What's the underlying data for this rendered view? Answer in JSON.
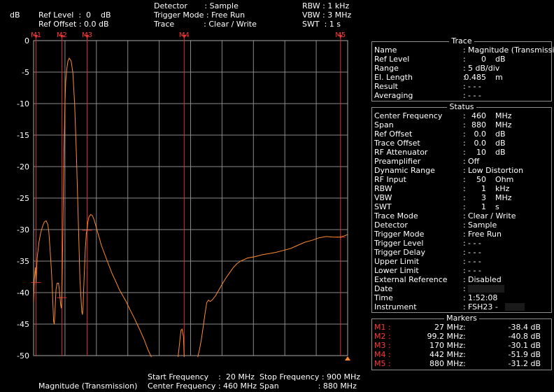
{
  "header": {
    "ylabel": "dB",
    "ref_level": "Ref Level  :  0    dB",
    "ref_offset": "Ref Offset : 0.0 dB",
    "detector": "Detector       : Sample",
    "trigger_mode": "Trigger Mode : Free Run",
    "trace": "Trace            : Clear / Write",
    "rbw": "RBW : 1 kHz",
    "vbw": "VBW : 3 MHz",
    "swt": "SWT  : 1 s"
  },
  "footer": {
    "mode": "Magnitude (Transmission)",
    "start_label": "Start Frequency    :  20 MHz",
    "center_label": "Center Frequency : 460 MHz",
    "stop_label": "Stop Frequency : 900 MHz",
    "span_label": "Span                : 880 MHz"
  },
  "marker_tags": [
    "M1",
    "M2",
    "M3",
    "M4",
    "M5"
  ],
  "trace_panel": {
    "title": "Trace",
    "rows": [
      {
        "label": "Name",
        "value": "Magnitude (Transmission)",
        "num": "",
        "unit": ""
      },
      {
        "label": "Ref Level",
        "value": "",
        "num": "0",
        "unit": "dB"
      },
      {
        "label": "Range",
        "value": "5 dB/div",
        "num": "",
        "unit": ""
      },
      {
        "label": "El. Length",
        "value": "",
        "num": "0.485",
        "unit": "m"
      },
      {
        "label": "Result",
        "value": "- - -",
        "num": "",
        "unit": ""
      },
      {
        "label": "Averaging",
        "value": "- - -",
        "num": "",
        "unit": ""
      }
    ]
  },
  "status_panel": {
    "title": "Status",
    "rows": [
      {
        "label": "Center Frequency",
        "value": "",
        "num": "460",
        "unit": "MHz"
      },
      {
        "label": "Span",
        "value": "",
        "num": "880",
        "unit": "MHz"
      },
      {
        "label": "Ref Offset",
        "value": "",
        "num": "0.0",
        "unit": "dB"
      },
      {
        "label": "Trace Offset",
        "value": "",
        "num": "0.0",
        "unit": "dB"
      },
      {
        "label": "RF Attenuator",
        "value": "",
        "num": "10",
        "unit": "dB"
      },
      {
        "label": "Preamplifier",
        "value": "Off",
        "num": "",
        "unit": ""
      },
      {
        "label": "Dynamic Range",
        "value": "Low Distortion",
        "num": "",
        "unit": ""
      },
      {
        "label": "RF Input",
        "value": "",
        "num": "50",
        "unit": "Ohm"
      },
      {
        "label": "RBW",
        "value": "",
        "num": "1",
        "unit": "kHz"
      },
      {
        "label": "VBW",
        "value": "",
        "num": "3",
        "unit": "MHz"
      },
      {
        "label": "SWT",
        "value": "",
        "num": "1",
        "unit": "s"
      },
      {
        "label": "Trace Mode",
        "value": "Clear / Write",
        "num": "",
        "unit": ""
      },
      {
        "label": "Detector",
        "value": "Sample",
        "num": "",
        "unit": ""
      },
      {
        "label": "Trigger Mode",
        "value": "Free Run",
        "num": "",
        "unit": ""
      },
      {
        "label": "Trigger Level",
        "value": "- - -",
        "num": "",
        "unit": ""
      },
      {
        "label": "Trigger Delay",
        "value": "- - -",
        "num": "",
        "unit": ""
      },
      {
        "label": "Upper Limit",
        "value": "- - -",
        "num": "",
        "unit": ""
      },
      {
        "label": "Lower Limit",
        "value": "- - -",
        "num": "",
        "unit": ""
      },
      {
        "label": "External Reference",
        "value": "Disabled",
        "num": "",
        "unit": ""
      },
      {
        "label": "Date",
        "value": "",
        "num": "",
        "unit": "",
        "redacted": true
      },
      {
        "label": "Time",
        "value": "1:52:08",
        "num": "",
        "unit": ""
      },
      {
        "label": "Instrument",
        "value": "FSH23 -",
        "num": "",
        "unit": "",
        "redacted": true
      }
    ]
  },
  "markers_panel": {
    "title": "Markers",
    "rows": [
      {
        "label": "M1 :",
        "freq": "27 MHz",
        "value": "-38.4 dB"
      },
      {
        "label": "M2 :",
        "freq": "99.2 MHz",
        "value": "-40.8 dB"
      },
      {
        "label": "M3 :",
        "freq": "170 MHz",
        "value": "-30.1 dB"
      },
      {
        "label": "M4 :",
        "freq": "442 MHz",
        "value": "-51.9 dB"
      },
      {
        "label": "M5 :",
        "freq": "880 MHz",
        "value": "-31.2 dB"
      }
    ]
  },
  "colors": {
    "trace": "#ff8a2a",
    "grid": "#8a8a8a",
    "marker": "#d83030",
    "marker_label": "#ff3a3a"
  },
  "chart_data": {
    "type": "line",
    "xlabel": "",
    "ylabel": "dB",
    "xlim": [
      20,
      900
    ],
    "ylim": [
      -50,
      0
    ],
    "yticks": [
      0,
      -5,
      -10,
      -15,
      -20,
      -25,
      -30,
      -35,
      -40,
      -45,
      -50
    ],
    "grid": true,
    "series": [
      {
        "name": "Magnitude (Transmission)",
        "x": [
          20,
          22,
          25,
          27,
          30,
          35,
          40,
          45,
          50,
          55,
          60,
          63,
          66,
          70,
          73,
          76,
          78,
          80,
          83,
          86,
          90,
          93,
          96,
          98,
          99.2,
          100,
          102,
          105,
          108,
          110,
          113,
          116,
          120,
          125,
          130,
          135,
          140,
          145,
          150,
          155,
          157,
          159,
          160,
          162,
          165,
          168,
          170,
          172,
          175,
          180,
          185,
          190,
          195,
          200,
          205,
          210,
          220,
          230,
          240,
          250,
          260,
          270,
          280,
          290,
          300,
          310,
          320,
          330,
          340,
          350,
          360,
          370,
          380,
          390,
          400,
          410,
          415,
          420,
          425,
          430,
          433,
          436,
          440,
          442,
          444,
          447,
          450,
          455,
          460,
          465,
          470,
          475,
          480,
          485,
          490,
          495,
          500,
          505,
          510,
          515,
          520,
          530,
          540,
          550,
          560,
          570,
          580,
          590,
          600,
          620,
          640,
          660,
          680,
          700,
          720,
          740,
          760,
          780,
          800,
          820,
          840,
          860,
          880,
          900
        ],
        "y": [
          -41.5,
          -38,
          -36,
          -38.4,
          -34.5,
          -32,
          -30.5,
          -29.5,
          -28.8,
          -28.6,
          -29.2,
          -30.5,
          -33,
          -36.5,
          -40,
          -44.5,
          -45,
          -43,
          -39.5,
          -38.5,
          -38.5,
          -40,
          -42,
          -42.5,
          -40.8,
          -38.5,
          -30.5,
          -18,
          -10,
          -6.5,
          -4.5,
          -3.3,
          -2.8,
          -3.2,
          -5,
          -10,
          -18,
          -28,
          -38,
          -43,
          -43.5,
          -42,
          -40,
          -37,
          -33,
          -30.5,
          -30.1,
          -28.8,
          -28,
          -27.6,
          -27.8,
          -28.5,
          -29.5,
          -30.5,
          -31.5,
          -32.5,
          -34,
          -35.5,
          -37,
          -38.2,
          -39.5,
          -40.5,
          -41.5,
          -42.7,
          -43.8,
          -45,
          -46.2,
          -47.5,
          -49,
          -50.5,
          -52,
          -53,
          -53,
          -52.5,
          -52,
          -51.5,
          -51.8,
          -52.5,
          -51,
          -47.5,
          -46,
          -45.8,
          -47,
          -51.9,
          -53,
          -53.5,
          -53,
          -52,
          -51,
          -51.5,
          -52,
          -51.5,
          -50.5,
          -49,
          -47.5,
          -45.5,
          -43.5,
          -41.6,
          -41.2,
          -41.4,
          -41.2,
          -40.5,
          -39.5,
          -38.5,
          -37.6,
          -36.8,
          -36,
          -35.4,
          -35,
          -34.5,
          -34.3,
          -34,
          -33.8,
          -33.6,
          -33.3,
          -33,
          -32.5,
          -32,
          -31.7,
          -31.3,
          -31.1,
          -31.2,
          -31.2,
          -30.8
        ]
      }
    ],
    "markers": [
      {
        "name": "M1",
        "x": 27,
        "y": -38.4
      },
      {
        "name": "M2",
        "x": 99.2,
        "y": -40.8
      },
      {
        "name": "M3",
        "x": 170,
        "y": -30.1
      },
      {
        "name": "M4",
        "x": 442,
        "y": -51.9
      },
      {
        "name": "M5",
        "x": 880,
        "y": -31.2
      }
    ]
  }
}
